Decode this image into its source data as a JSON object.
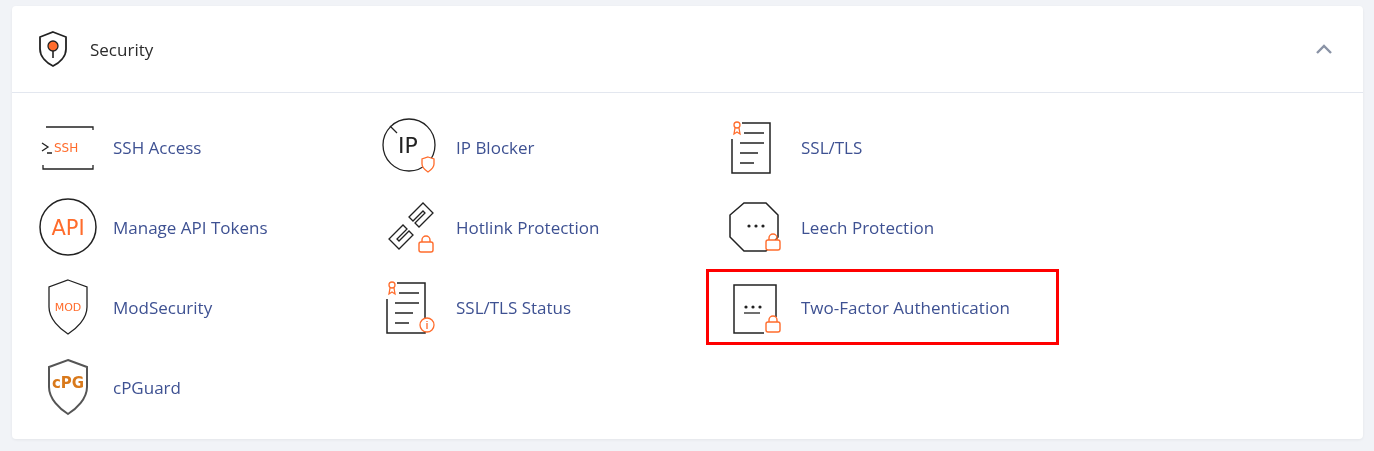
{
  "section": {
    "title": "Security",
    "expanded": true
  },
  "items": [
    {
      "label": "SSH Access",
      "kind": "ssh",
      "icon_text": "SSH",
      "highlighted": false
    },
    {
      "label": "IP Blocker",
      "kind": "ip",
      "icon_text": "IP",
      "highlighted": false
    },
    {
      "label": "SSL/TLS",
      "kind": "ssl",
      "highlighted": false
    },
    {
      "label": "Manage API Tokens",
      "kind": "api",
      "icon_text": "API",
      "highlighted": false
    },
    {
      "label": "Hotlink Protection",
      "kind": "hotlink",
      "highlighted": false
    },
    {
      "label": "Leech Protection",
      "kind": "leech",
      "highlighted": false
    },
    {
      "label": "ModSecurity",
      "kind": "mod",
      "icon_text": "MOD",
      "highlighted": false
    },
    {
      "label": "SSL/TLS Status",
      "kind": "sslstatus",
      "highlighted": false
    },
    {
      "label": "Two-Factor Authentication",
      "kind": "twofactor",
      "highlighted": true
    },
    {
      "label": "cPGuard",
      "kind": "cpg",
      "icon_text": "cPG",
      "highlighted": false
    }
  ]
}
